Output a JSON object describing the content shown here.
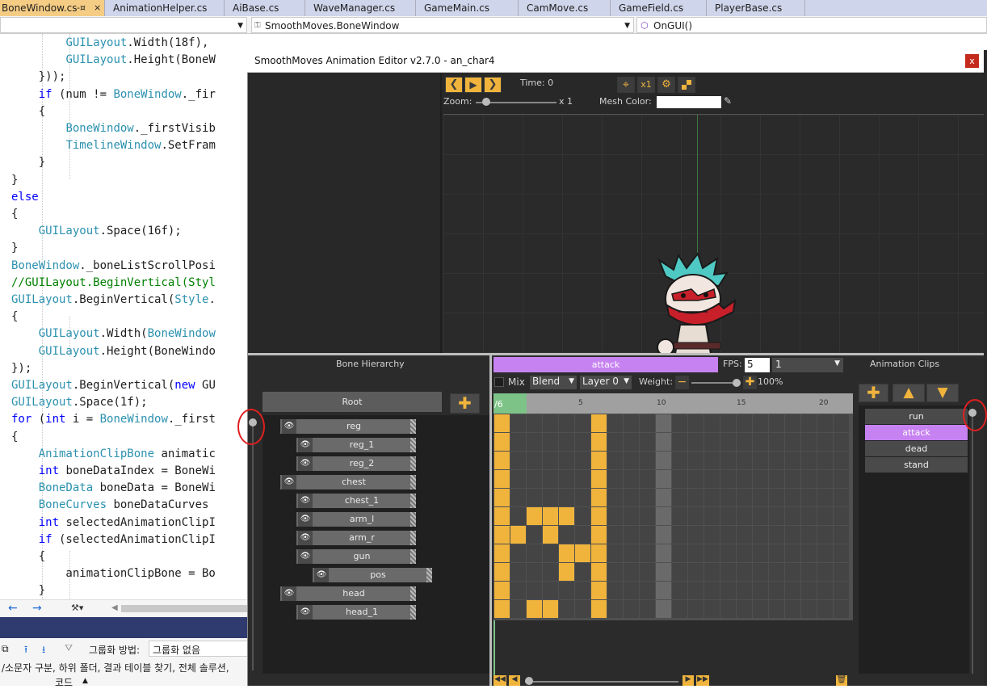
{
  "tabs": [
    {
      "label": "BoneWindow.cs",
      "active": true,
      "pin": "-¤",
      "close": "×"
    },
    {
      "label": "AnimationHelper.cs"
    },
    {
      "label": "AiBase.cs"
    },
    {
      "label": "WaveManager.cs"
    },
    {
      "label": "GameMain.cs"
    },
    {
      "label": "CamMove.cs"
    },
    {
      "label": "GameField.cs"
    },
    {
      "label": "PlayerBase.cs"
    }
  ],
  "nav": {
    "class": "SmoothMoves.BoneWindow",
    "member": "OnGUI()"
  },
  "code_lines": [
    "        GUILayout.Width(18f),",
    "        GUILayout.Height(BoneW",
    "    }));",
    "    if (num != BoneWindow._fir",
    "    {",
    "        BoneWindow._firstVisib",
    "        TimelineWindow.SetFram",
    "    }",
    "}",
    "else",
    "{",
    "    GUILayout.Space(16f);",
    "}",
    "BoneWindow._boneListScrollPosi",
    "//GUILayout.BeginVertical(Styl",
    "GUILayout.BeginVertical(Style.",
    "{",
    "    GUILayout.Width(BoneWindow",
    "    GUILayout.Height(BoneWindo",
    "});",
    "GUILayout.BeginVertical(new GU",
    "GUILayout.Space(1f);",
    "for (int i = BoneWindow._first",
    "{",
    "    AnimationClipBone animatic",
    "    int boneDataIndex = BoneWi",
    "    BoneData boneData = BoneWi",
    "    BoneCurves boneDataCurves ",
    "    int selectedAnimationClipI",
    "    if (selectedAnimationClipI",
    "    {",
    "        animationClipBone = Bo",
    "    }"
  ],
  "find_bar": {
    "group_label": "그룹화 방법:",
    "group_value": "그룹화 없음",
    "scope_text": "/소문자 구분, 하위 폴더, 결과 테이블 찾기, 전체 솔루션,",
    "code_label": "코드"
  },
  "editor": {
    "title": "SmoothMoves Animation Editor v2.7.0 - an_char4",
    "close": "x",
    "time_label": "Time: 0",
    "x1_label": "x1",
    "zoom_label": "Zoom:",
    "zoom_value": "x 1",
    "mesh_color_label": "Mesh Color:",
    "bone_hierarchy_title": "Bone Hierarchy",
    "root_label": "Root",
    "bones": [
      {
        "name": "reg",
        "level": 0
      },
      {
        "name": "reg_1",
        "level": 1
      },
      {
        "name": "reg_2",
        "level": 1
      },
      {
        "name": "chest",
        "level": 0
      },
      {
        "name": "chest_1",
        "level": 1
      },
      {
        "name": "arm_l",
        "level": 1
      },
      {
        "name": "arm_r",
        "level": 1
      },
      {
        "name": "gun",
        "level": 1
      },
      {
        "name": "pos",
        "level": 2
      },
      {
        "name": "head",
        "level": 0
      },
      {
        "name": "head_1",
        "level": 1
      }
    ],
    "clip_name": "attack",
    "fps_label": "FPS:",
    "fps_value": "5",
    "frame_value": "1",
    "mix_label": "Mix",
    "blend_label": "Blend",
    "layer_label": "Layer 0",
    "weight_label": "Weight:",
    "weight_value": "100%",
    "timeline_ticks": [
      "/6",
      "5",
      "10",
      "15",
      "20"
    ],
    "animation_clips_title": "Animation Clips",
    "clips": [
      {
        "name": "run",
        "selected": false
      },
      {
        "name": "attack",
        "selected": true
      },
      {
        "name": "dead",
        "selected": false
      },
      {
        "name": "stand",
        "selected": false
      }
    ]
  },
  "colors": {
    "accent_orange": "#f0b43c",
    "clip_purple": "#c682f0",
    "frame_green": "#7dc387",
    "tab_active": "#f5cc84",
    "vs_darkband": "#2f3a6e"
  }
}
